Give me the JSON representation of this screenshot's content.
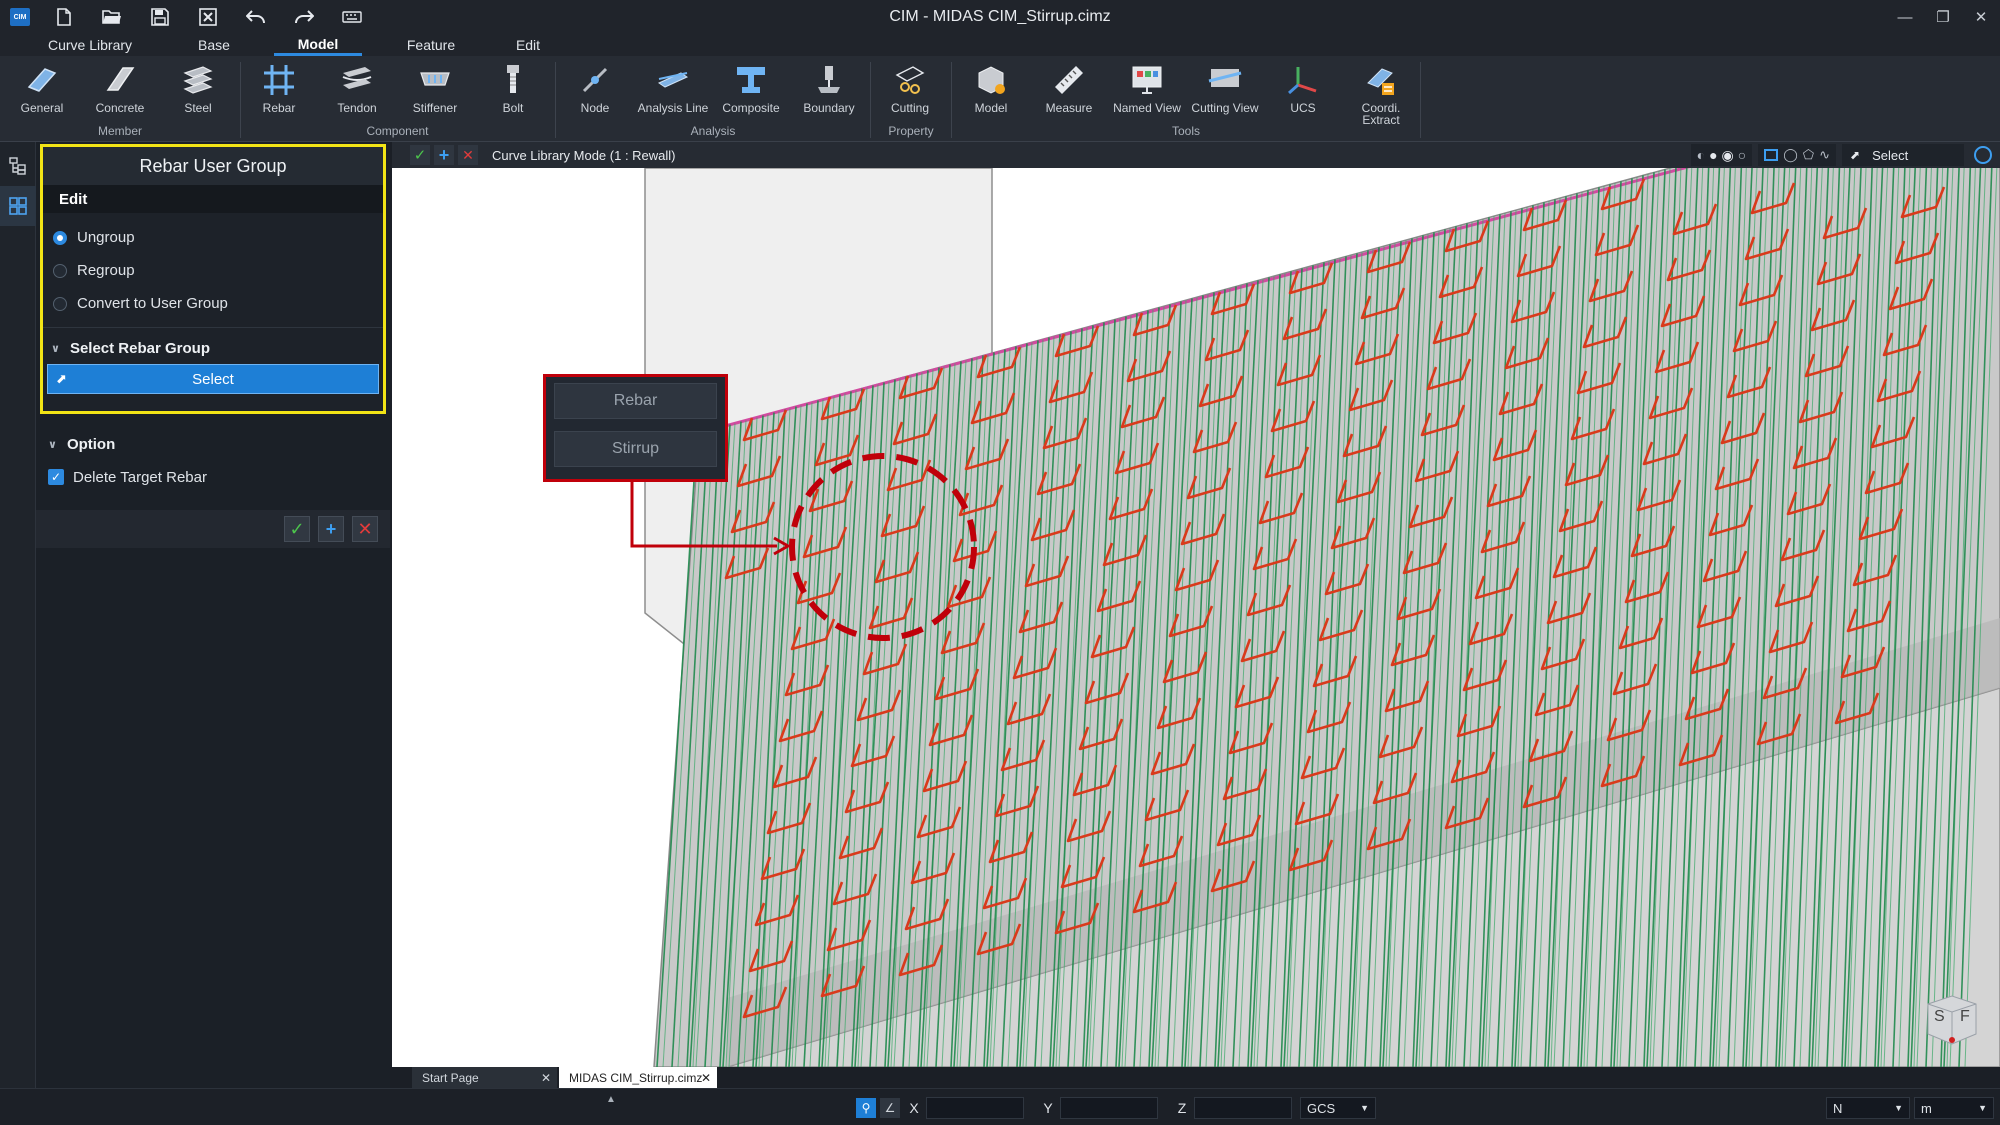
{
  "titlebar": {
    "app_logo": "CIM",
    "title": "CIM - MIDAS CIM_Stirrup.cimz",
    "quick_access": [
      "new-file-icon",
      "open-folder-icon",
      "save-icon",
      "close-file-icon",
      "undo-icon",
      "redo-icon",
      "keyboard-icon"
    ]
  },
  "menu_tabs": [
    {
      "label": "Curve Library",
      "active": false
    },
    {
      "label": "Base",
      "active": false
    },
    {
      "label": "Model",
      "active": true
    },
    {
      "label": "Feature",
      "active": false
    },
    {
      "label": "Edit",
      "active": false
    }
  ],
  "ribbon": {
    "buttons": [
      {
        "label": "General"
      },
      {
        "label": "Concrete"
      },
      {
        "label": "Steel"
      },
      {
        "label": "Rebar"
      },
      {
        "label": "Tendon"
      },
      {
        "label": "Stiffener"
      },
      {
        "label": "Bolt"
      },
      {
        "label": "Node"
      },
      {
        "label": "Analysis Line"
      },
      {
        "label": "Composite"
      },
      {
        "label": "Boundary"
      },
      {
        "label": "Cutting"
      },
      {
        "label": "Model"
      },
      {
        "label": "Measure"
      },
      {
        "label": "Named View"
      },
      {
        "label": "Cutting View"
      },
      {
        "label": "UCS"
      },
      {
        "label": "Coordi. Extract"
      }
    ],
    "groups": [
      "Member",
      "Component",
      "Analysis",
      "Property",
      "Tools"
    ]
  },
  "panel": {
    "title": "Rebar User Group",
    "edit_label": "Edit",
    "options": [
      {
        "label": "Ungroup",
        "selected": true
      },
      {
        "label": "Regroup",
        "selected": false
      },
      {
        "label": "Convert to User Group",
        "selected": false
      }
    ],
    "select_group_heading": "Select Rebar Group",
    "select_button": "Select",
    "option_heading": "Option",
    "delete_target_label": "Delete Target Rebar",
    "delete_target_checked": true
  },
  "viewbar": {
    "mode_label": "Curve Library Mode (1 : Rewall)",
    "select_label": "Select"
  },
  "viewport": {
    "callout_items": [
      "Rebar",
      "Stirrup"
    ],
    "cube_labels": [
      "S",
      "F"
    ]
  },
  "doc_tabs": [
    {
      "label": "Start Page",
      "active": false
    },
    {
      "label": "MIDAS CIM_Stirrup.cimz",
      "active": true
    }
  ],
  "statusbar": {
    "x_label": "X",
    "y_label": "Y",
    "z_label": "Z",
    "coord_system": "GCS",
    "force_unit": "N",
    "length_unit": "m"
  },
  "colors": {
    "accent": "#1e7fd6",
    "highlight": "#f2e416",
    "callout_red": "#c0000a",
    "stirrup": "#d93a1c",
    "rebar": "#1f8a4c"
  }
}
